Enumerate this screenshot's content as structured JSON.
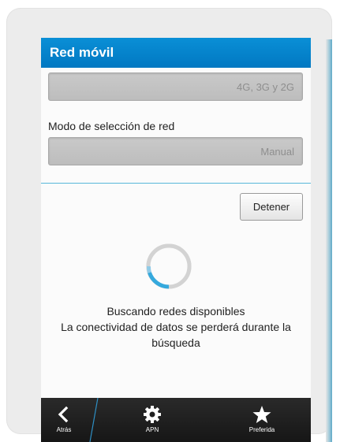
{
  "titlebar": {
    "title": "Red móvil"
  },
  "network_mode": {
    "value": "4G, 3G y 2G"
  },
  "selection_mode": {
    "label": "Modo de selección de red",
    "value": "Manual"
  },
  "stop_button": {
    "label": "Detener"
  },
  "status": {
    "line1": "Buscando redes disponibles",
    "line2": "La conectividad de datos se perderá durante la",
    "line3": "búsqueda"
  },
  "actionbar": {
    "back_label": "Atrás",
    "back_icon": "chevron-left-icon",
    "apn_label": "APN",
    "apn_icon": "gear-icon",
    "favorite_label": "Preferida",
    "favorite_icon": "star-icon"
  },
  "colors": {
    "titlebar": "#0a8fd6",
    "accent": "#58b8d9",
    "actionbar": "#1f1f1f"
  }
}
